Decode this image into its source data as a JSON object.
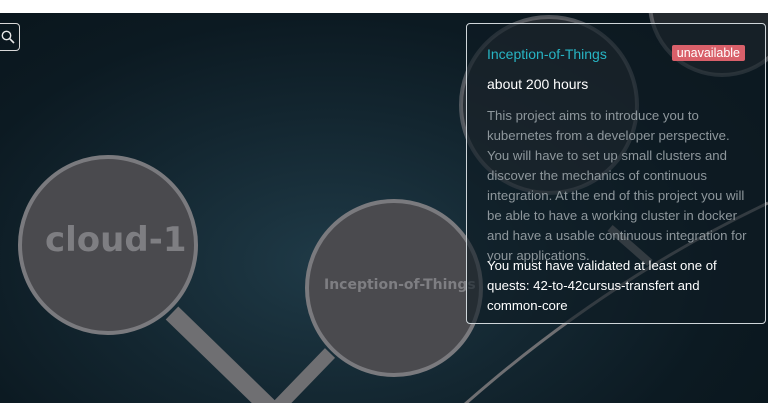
{
  "graph": {
    "nodes": [
      {
        "id": "cloud-1",
        "label": "cloud-1"
      },
      {
        "id": "inception",
        "label": "Inception-of-Things"
      }
    ]
  },
  "search": {
    "icon": "search-icon"
  },
  "project_panel": {
    "title": "Inception-of-Things",
    "status": "unavailable",
    "duration": "about 200 hours",
    "description": "This project aims to introduce you to kubernetes from a developer perspective. You will have to set up small clusters and discover the mechanics of continuous integration. At the end of this project you will be able to have a working cluster in docker and have a usable continuous integration for your applications.",
    "requirement": "You must have validated at least one of quests: 42-to-42cursus-transfert and common-core"
  },
  "colors": {
    "title": "#27b5c4",
    "badge": "#d9606a",
    "node_fill": "#4a4a4e",
    "node_border": "#7a7a7e",
    "link": "#6f6f72"
  }
}
